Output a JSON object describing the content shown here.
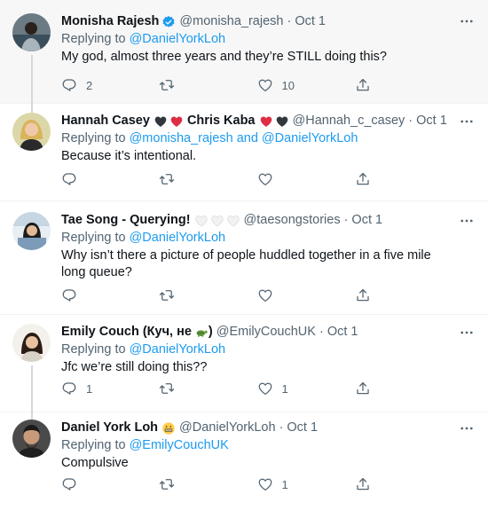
{
  "tweets": [
    {
      "name": "Monisha Rajesh",
      "handle": "@monisha_rajesh",
      "time": "Oct 1",
      "replying_prefix": "Replying to ",
      "replying_to": "@DanielYorkLoh",
      "text": "My god, almost three years and they’re STILL doing this?",
      "reply_count": "2",
      "retweet_count": "",
      "like_count": "10"
    },
    {
      "name": "Hannah Casey",
      "name2": "Chris Kaba",
      "handle": "@Hannah_c_casey",
      "time": "Oct 1",
      "replying_prefix": "Replying to ",
      "replying_to": "@monisha_rajesh and @DanielYorkLoh",
      "text": "Because it’s intentional.",
      "reply_count": "",
      "retweet_count": "",
      "like_count": ""
    },
    {
      "name": "Tae Song - Querying!",
      "handle": "@taesongstories",
      "time": "Oct 1",
      "replying_prefix": "Replying to ",
      "replying_to": "@DanielYorkLoh",
      "text": "Why isn’t there a picture of people huddled together in a five mile long queue?",
      "reply_count": "",
      "retweet_count": "",
      "like_count": ""
    },
    {
      "name": "Emily Couch (Куч, не",
      "name_suffix": ")",
      "handle": "@EmilyCouchUK",
      "time": "Oct 1",
      "replying_prefix": "Replying to ",
      "replying_to": "@DanielYorkLoh",
      "text": "Jfc we’re still doing this??",
      "reply_count": "1",
      "retweet_count": "",
      "like_count": "1"
    },
    {
      "name": "Daniel York Loh",
      "handle": "@DanielYorkLoh",
      "time": "Oct 1",
      "replying_prefix": "Replying to ",
      "replying_to": "@EmilyCouchUK",
      "text": "Compulsive",
      "reply_count": "",
      "retweet_count": "",
      "like_count": "1"
    }
  ],
  "dot": "·",
  "colors": {
    "link": "#1d9bf0",
    "muted": "#536471",
    "text": "#0f1419",
    "heart_red": "#dd2e44",
    "heart_black": "#31373d",
    "verified": "#1d9bf0"
  },
  "icons": {
    "reply": "reply-icon",
    "retweet": "retweet-icon",
    "like": "like-icon",
    "share": "share-icon",
    "more": "more-icon",
    "verified": "verified-badge-icon"
  }
}
